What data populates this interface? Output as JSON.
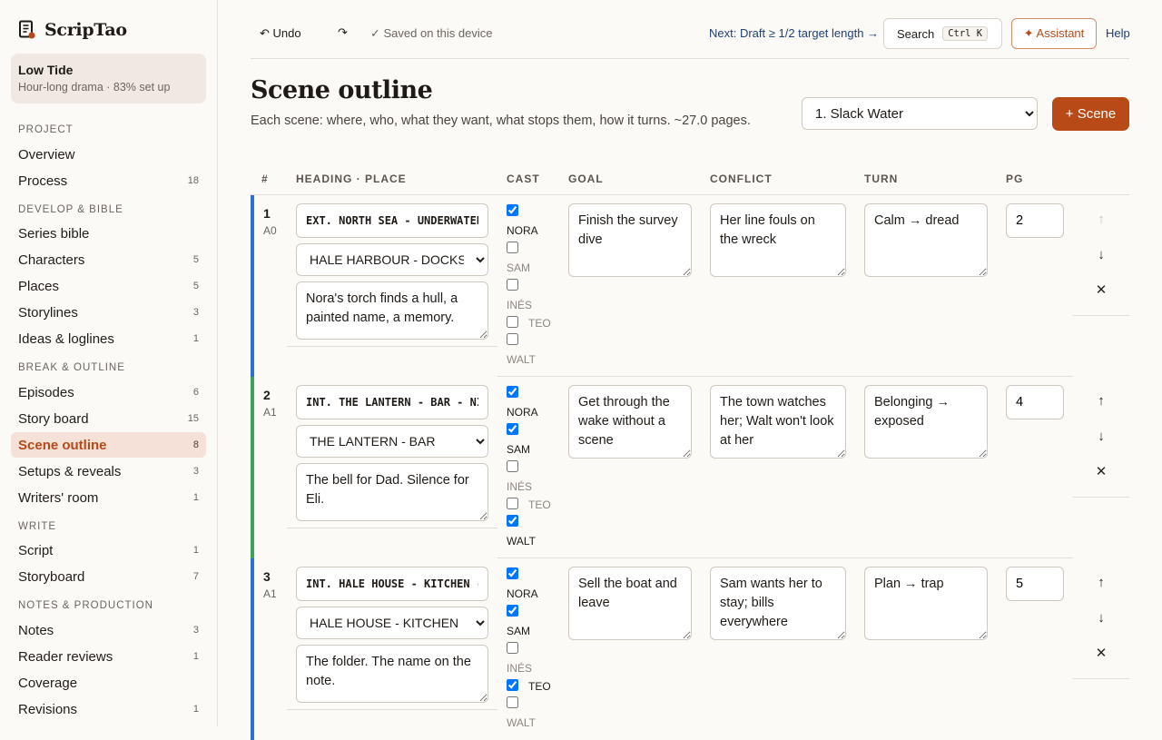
{
  "app": {
    "name": "ScripTao"
  },
  "project": {
    "title": "Low Tide",
    "subtitle": "Hour-long drama · 83% set up"
  },
  "sidebar": {
    "sections": [
      {
        "label": "Project"
      },
      {
        "label": "Develop & Bible"
      },
      {
        "label": "Break & Outline"
      },
      {
        "label": "Write"
      },
      {
        "label": "Notes & Production"
      }
    ],
    "items": [
      {
        "label": "Overview",
        "count": ""
      },
      {
        "label": "Process",
        "count": "18"
      },
      {
        "label": "Series bible",
        "count": ""
      },
      {
        "label": "Characters",
        "count": "5"
      },
      {
        "label": "Places",
        "count": "5"
      },
      {
        "label": "Storylines",
        "count": "3"
      },
      {
        "label": "Ideas & loglines",
        "count": "1"
      },
      {
        "label": "Episodes",
        "count": "6"
      },
      {
        "label": "Story board",
        "count": "15"
      },
      {
        "label": "Scene outline",
        "count": "8"
      },
      {
        "label": "Setups & reveals",
        "count": "3"
      },
      {
        "label": "Writers' room",
        "count": "1"
      },
      {
        "label": "Script",
        "count": "1"
      },
      {
        "label": "Storyboard",
        "count": "7"
      },
      {
        "label": "Notes",
        "count": "3"
      },
      {
        "label": "Reader reviews",
        "count": "1"
      },
      {
        "label": "Coverage",
        "count": ""
      },
      {
        "label": "Revisions",
        "count": "1"
      }
    ]
  },
  "topbar": {
    "undo": "↶ Undo",
    "redo": "↷",
    "saved": "✓ Saved on this device",
    "next": "Next: Draft ≥ 1/2 target length →",
    "search": "Search",
    "search_kbd": "Ctrl K",
    "assistant": "✦ Assistant",
    "help": "Help"
  },
  "page": {
    "title": "Scene outline",
    "subtitle": "Each scene: where, who, what they want, what stops them, how it turns. ~27.0 pages.",
    "episode_selected": "1. Slack Water",
    "add_scene": "+ Scene"
  },
  "columns": [
    "#",
    "Heading · Place",
    "Cast",
    "Goal",
    "Conflict",
    "Turn",
    "PG"
  ],
  "colors": {
    "accent": "#b84a18",
    "stripe_a0": "#2f6fd6",
    "stripe_a1_green": "#3aa35c",
    "stripe_a1_blue": "#2f6fd6"
  },
  "scenes": [
    {
      "num": "1",
      "act": "A0",
      "heading": "EXT. NORTH SEA - UNDERWATER - DAY",
      "place": "HALE HARBOUR - DOCKS",
      "summary": "Nora's torch finds a hull, a painted name, a memory.",
      "cast": [
        {
          "name": "NORA",
          "on": true
        },
        {
          "name": "SAM",
          "on": false
        },
        {
          "name": "INÉS",
          "on": false
        },
        {
          "name": "TEO",
          "on": false
        },
        {
          "name": "WALT",
          "on": false
        }
      ],
      "goal": "Finish the survey dive",
      "conflict": "Her line fouls on the wreck",
      "turn": "Calm → dread",
      "pg": "2",
      "up": "↑",
      "down": "↓",
      "delete": "✕"
    },
    {
      "num": "2",
      "act": "A1",
      "heading": "INT. THE LANTERN - BAR - NIGHT",
      "place": "THE LANTERN - BAR",
      "summary": "The bell for Dad. Silence for Eli.",
      "cast": [
        {
          "name": "NORA",
          "on": true
        },
        {
          "name": "SAM",
          "on": true
        },
        {
          "name": "INÉS",
          "on": false
        },
        {
          "name": "TEO",
          "on": false
        },
        {
          "name": "WALT",
          "on": true
        }
      ],
      "goal": "Get through the wake without a scene",
      "conflict": "The town watches her; Walt won't look at her",
      "turn": "Belonging → exposed",
      "pg": "4",
      "up": "↑",
      "down": "↓",
      "delete": "✕"
    },
    {
      "num": "3",
      "act": "A1",
      "heading": "INT. HALE HOUSE - KITCHEN - DAY",
      "place": "HALE HOUSE - KITCHEN",
      "summary": "The folder. The name on the note.",
      "cast": [
        {
          "name": "NORA",
          "on": true
        },
        {
          "name": "SAM",
          "on": true
        },
        {
          "name": "INÉS",
          "on": false
        },
        {
          "name": "TEO",
          "on": true
        },
        {
          "name": "WALT",
          "on": false
        }
      ],
      "goal": "Sell the boat and leave",
      "conflict": "Sam wants her to stay; bills everywhere",
      "turn": "Plan → trap",
      "pg": "5",
      "up": "↑",
      "down": "↓",
      "delete": "✕"
    }
  ]
}
